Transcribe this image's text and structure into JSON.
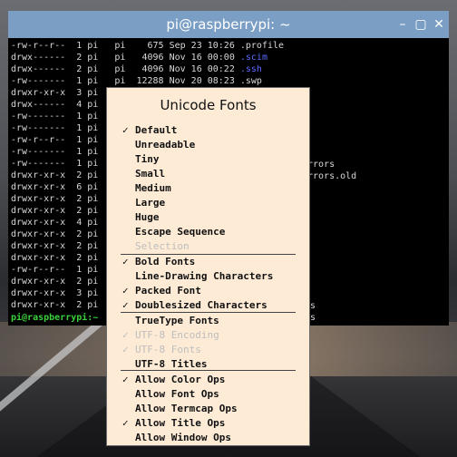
{
  "window": {
    "title": "pi@raspberrypi: ~",
    "controls": {
      "minimize": "–",
      "maximize": "▢",
      "close": "✕"
    }
  },
  "terminal": {
    "lines": [
      [
        "-rw-r--r--  1 pi   pi    675 Sep 23 10:26 ",
        ".profile",
        "white"
      ],
      [
        "drwx------  2 pi   pi   4096 Nov 16 00:00 ",
        ".scim",
        "blue"
      ],
      [
        "drwx------  2 pi   pi   4096 Nov 16 00:22 ",
        ".ssh",
        "blue"
      ],
      [
        "-rw-------  1 pi   pi  12288 Nov 20 08:23 ",
        ".swp",
        "white"
      ],
      [
        "drwxr-xr-x  3 pi",
        "",
        "white"
      ],
      [
        "drwx------  4 pi",
        "",
        "white"
      ],
      [
        "-rw-------  1 pi",
        "",
        "white"
      ],
      [
        "-rw-------  1 pi",
        "",
        "white"
      ],
      [
        "-rw-r--r--  1 pi",
        "",
        "white"
      ],
      [
        "-rw-------  1 pi",
        "",
        "white"
      ],
      [
        "-rw-------  1 pi",
        "",
        "white"
      ],
      [
        "drwxr-xr-x  2 pi",
        "",
        "white"
      ],
      [
        "drwxr-xr-x  6 pi",
        "",
        "white"
      ],
      [
        "drwxr-xr-x  2 pi",
        "",
        "white"
      ],
      [
        "drwxr-xr-x  2 pi",
        "",
        "white"
      ],
      [
        "drwxr-xr-x  4 pi",
        "",
        "white"
      ],
      [
        "drwxr-xr-x  2 pi",
        "",
        "white"
      ],
      [
        "drwxr-xr-x  2 pi",
        "",
        "white"
      ],
      [
        "drwxr-xr-x  2 pi",
        "",
        "white"
      ],
      [
        "-rw-r--r--  1 pi",
        "",
        "white"
      ],
      [
        "drwxr-xr-x  2 pi",
        "",
        "white"
      ],
      [
        "drwxr-xr-x  3 pi",
        "",
        "white"
      ],
      [
        "drwxr-xr-x  2 pi",
        "",
        "white"
      ]
    ],
    "overflow_text": {
      "errors": "rrors",
      "errors_old": "rrors.old",
      "s1": "s",
      "s2": "s"
    },
    "prompt": "pi@raspberrypi:~"
  },
  "menu": {
    "title": "Unicode Fonts",
    "items": [
      {
        "label": "Default",
        "checked": true,
        "disabled": false
      },
      {
        "label": "Unreadable",
        "checked": false,
        "disabled": false
      },
      {
        "label": "Tiny",
        "checked": false,
        "disabled": false
      },
      {
        "label": "Small",
        "checked": false,
        "disabled": false
      },
      {
        "label": "Medium",
        "checked": false,
        "disabled": false
      },
      {
        "label": "Large",
        "checked": false,
        "disabled": false
      },
      {
        "label": "Huge",
        "checked": false,
        "disabled": false
      },
      {
        "label": "Escape Sequence",
        "checked": false,
        "disabled": false
      },
      {
        "label": "Selection",
        "checked": false,
        "disabled": true
      },
      {
        "label": "Bold Fonts",
        "checked": true,
        "disabled": false
      },
      {
        "label": "Line-Drawing Characters",
        "checked": false,
        "disabled": false
      },
      {
        "label": "Packed Font",
        "checked": true,
        "disabled": false
      },
      {
        "label": "Doublesized Characters",
        "checked": true,
        "disabled": false
      },
      {
        "label": "TrueType Fonts",
        "checked": false,
        "disabled": false
      },
      {
        "label": "UTF-8 Encoding",
        "checked": true,
        "disabled": true
      },
      {
        "label": "UTF-8 Fonts",
        "checked": true,
        "disabled": true
      },
      {
        "label": "UTF-8 Titles",
        "checked": false,
        "disabled": false
      },
      {
        "label": "Allow Color Ops",
        "checked": true,
        "disabled": false
      },
      {
        "label": "Allow Font Ops",
        "checked": false,
        "disabled": false
      },
      {
        "label": "Allow Termcap Ops",
        "checked": false,
        "disabled": false
      },
      {
        "label": "Allow Title Ops",
        "checked": true,
        "disabled": false
      },
      {
        "label": "Allow Window Ops",
        "checked": false,
        "disabled": false
      }
    ],
    "check_glyph": "✓"
  }
}
